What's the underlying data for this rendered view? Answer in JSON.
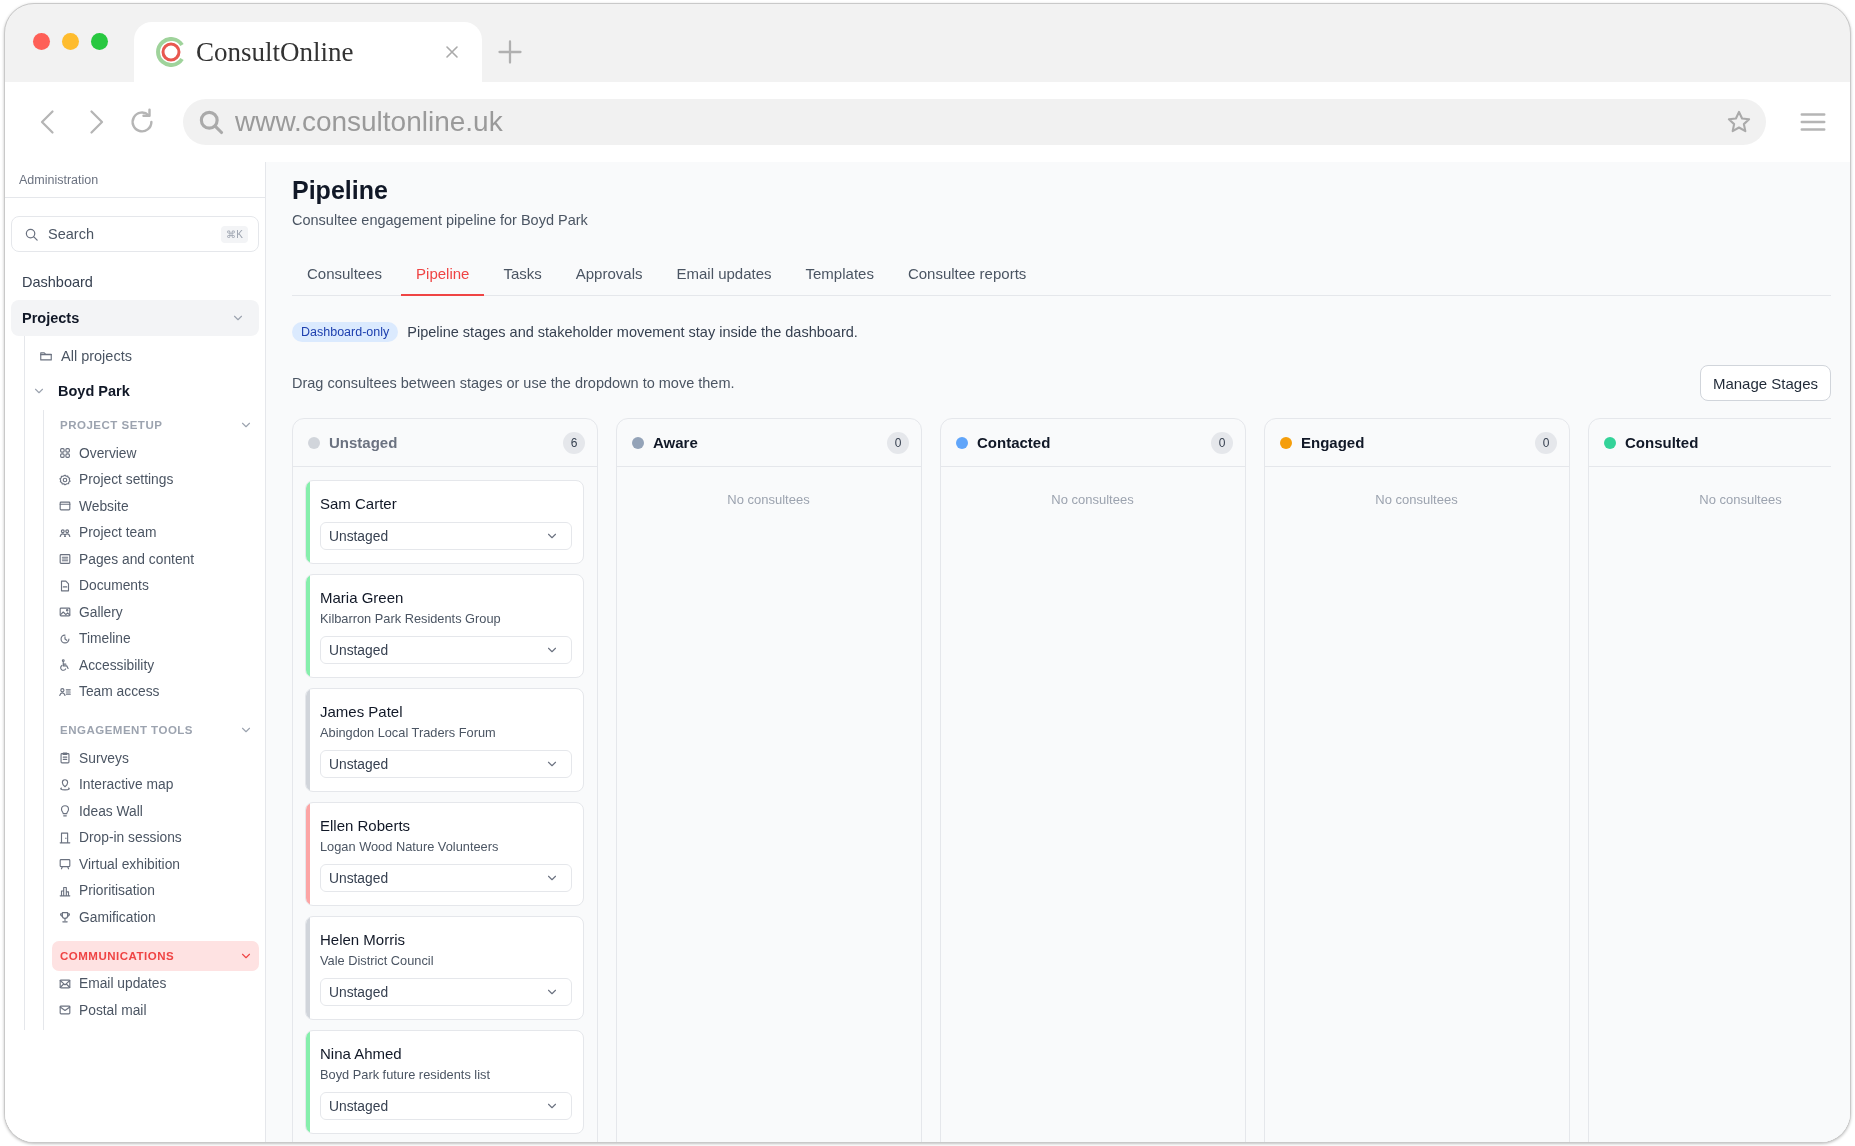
{
  "browser": {
    "tab_title": "ConsultOnline",
    "url": "www.consultonline.uk"
  },
  "sidebar": {
    "title": "Administration",
    "search": {
      "placeholder": "Search",
      "shortcut": "⌘K"
    },
    "items": [
      {
        "label": "Dashboard",
        "selected": false
      },
      {
        "label": "Projects",
        "selected": true,
        "expanded": true,
        "children": [
          {
            "label": "All projects"
          },
          {
            "label": "Boyd Park",
            "expanded": true,
            "sections": [
              {
                "title": "PROJECT SETUP",
                "selected": false,
                "expanded": true,
                "items": [
                  {
                    "label": "Overview"
                  },
                  {
                    "label": "Project settings"
                  },
                  {
                    "label": "Website"
                  },
                  {
                    "label": "Project team"
                  },
                  {
                    "label": "Pages and content"
                  },
                  {
                    "label": "Documents"
                  },
                  {
                    "label": "Gallery"
                  },
                  {
                    "label": "Timeline"
                  },
                  {
                    "label": "Accessibility"
                  },
                  {
                    "label": "Team access"
                  }
                ]
              },
              {
                "title": "ENGAGEMENT TOOLS",
                "selected": false,
                "expanded": true,
                "items": [
                  {
                    "label": "Surveys"
                  },
                  {
                    "label": "Interactive map"
                  },
                  {
                    "label": "Ideas Wall"
                  },
                  {
                    "label": "Drop-in sessions"
                  },
                  {
                    "label": "Virtual exhibition"
                  },
                  {
                    "label": "Prioritisation"
                  },
                  {
                    "label": "Gamification"
                  }
                ]
              },
              {
                "title": "COMMUNICATIONS",
                "selected": true,
                "expanded": true,
                "items": [
                  {
                    "label": "Email updates"
                  },
                  {
                    "label": "Postal mail"
                  }
                ]
              }
            ]
          }
        ]
      }
    ]
  },
  "page": {
    "title": "Pipeline",
    "subtitle": "Consultee engagement pipeline for Boyd Park",
    "tabs": [
      {
        "label": "Consultees",
        "selected": false
      },
      {
        "label": "Pipeline",
        "selected": true
      },
      {
        "label": "Tasks",
        "selected": false
      },
      {
        "label": "Approvals",
        "selected": false
      },
      {
        "label": "Email updates",
        "selected": false
      },
      {
        "label": "Templates",
        "selected": false
      },
      {
        "label": "Consultee reports",
        "selected": false
      }
    ],
    "notice": {
      "badge": "Dashboard-only",
      "text": "Pipeline stages and stakeholder movement stay inside the dashboard."
    },
    "hint": "Drag consultees between stages or use the dropdown to move them.",
    "manage_button": "Manage Stages",
    "columns": [
      {
        "kind": "unstaged",
        "name": "Unstaged",
        "color": "#d1d5db",
        "count": "6",
        "cards": [
          {
            "name": "Sam Carter",
            "stage": "Unstaged",
            "color": "#86efac"
          },
          {
            "name": "Maria Green",
            "organisation": "Kilbarron Park Residents Group",
            "stage": "Unstaged",
            "color": "#86efac"
          },
          {
            "name": "James Patel",
            "organisation": "Abingdon Local Traders Forum",
            "stage": "Unstaged",
            "color": "#d1d5db"
          },
          {
            "name": "Ellen Roberts",
            "organisation": "Logan Wood Nature Volunteers",
            "stage": "Unstaged",
            "color": "#fca5a5"
          },
          {
            "name": "Helen Morris",
            "organisation": "Vale District Council",
            "stage": "Unstaged",
            "color": "#d1d5db"
          },
          {
            "name": "Nina Ahmed",
            "organisation": "Boyd Park future residents list",
            "stage": "Unstaged",
            "color": "#86efac"
          }
        ]
      },
      {
        "kind": "stage",
        "name": "Aware",
        "color": "#94a3b8",
        "count": "0",
        "empty_text": "No consultees"
      },
      {
        "kind": "stage",
        "name": "Contacted",
        "color": "#60a5fa",
        "count": "0",
        "empty_text": "No consultees"
      },
      {
        "kind": "stage",
        "name": "Engaged",
        "color": "#f59e0b",
        "count": "0",
        "empty_text": "No consultees"
      },
      {
        "kind": "stage",
        "name": "Consulted",
        "color": "#34d399",
        "empty_text": "No consultees"
      }
    ]
  }
}
